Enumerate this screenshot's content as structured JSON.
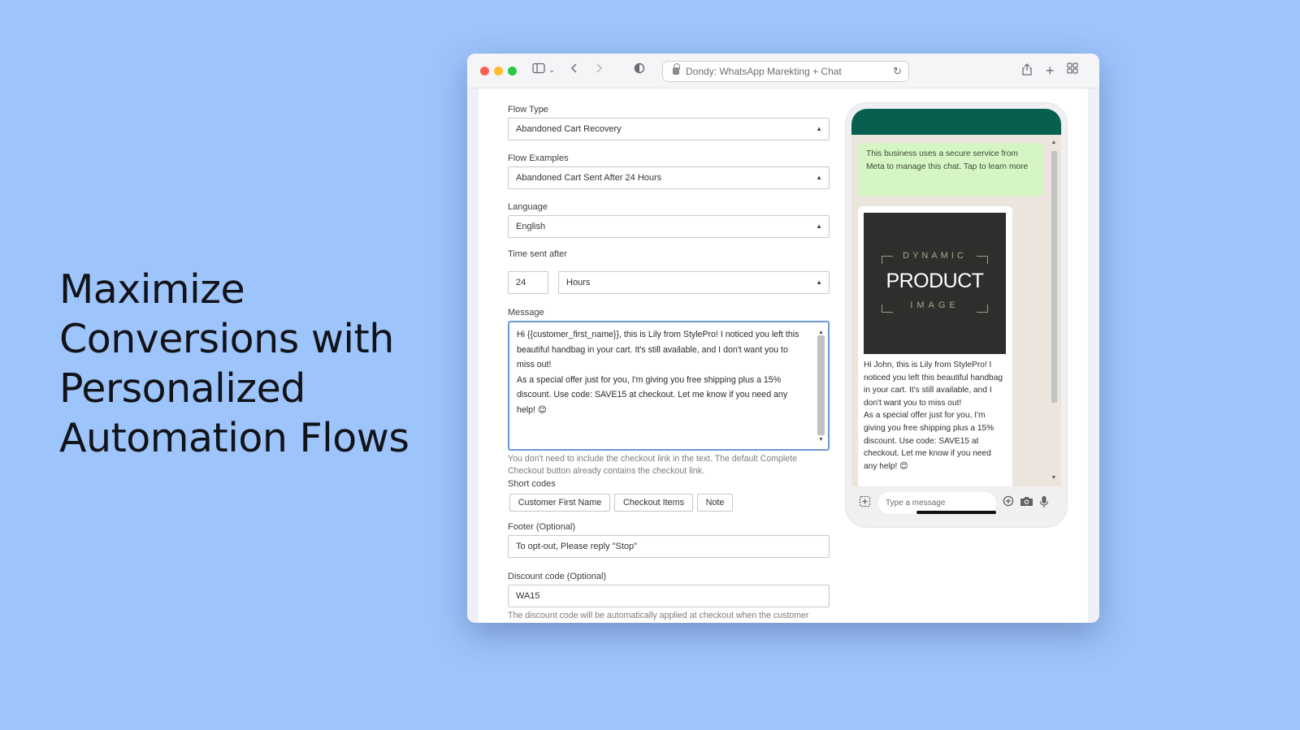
{
  "headline": [
    "Maximize",
    "Conversions with",
    "Personalized",
    "Automation Flows"
  ],
  "browser": {
    "address": "Dondy: WhatsApp Marekting + Chat",
    "icons": [
      "sidebar-icon",
      "chevron-down-icon",
      "back-icon",
      "forward-icon",
      "privacy-shield-icon",
      "lock-icon",
      "reload-icon",
      "share-icon",
      "new-tab-icon",
      "tab-overview-icon"
    ]
  },
  "form": {
    "flow_type": {
      "label": "Flow Type",
      "value": "Abandoned Cart Recovery"
    },
    "flow_examples": {
      "label": "Flow Examples",
      "value": "Abandoned Cart Sent After 24 Hours"
    },
    "language": {
      "label": "Language",
      "value": "English"
    },
    "time_sent": {
      "label": "Time sent after",
      "amount": "24",
      "unit": "Hours"
    },
    "message": {
      "label": "Message",
      "line1": "Hi {{customer_first_name}}, this is Lily from StylePro! I noticed you left this beautiful handbag in your cart. It's still available, and I don't want you to miss out!",
      "line2": "As a special offer just for you, I'm giving you free shipping plus a 15% discount. Use code: SAVE15 at checkout. Let me know if you need any help! 😊"
    },
    "checkout_hint": "You don't need to include the checkout link in the text. The default Complete Checkout button already contains the checkout link.",
    "short_codes": {
      "label": "Short codes",
      "items": [
        "Customer First Name",
        "Checkout Items",
        "Note"
      ]
    },
    "footer": {
      "label": "Footer (Optional)",
      "value": "To opt-out, Please reply \"Stop\""
    },
    "discount": {
      "label": "Discount code (Optional)",
      "value": "WA15",
      "hint": "The discount code will be automatically applied at checkout when the customer"
    }
  },
  "preview": {
    "security_notice": "This business uses a secure service from Meta to manage this chat. Tap to learn more",
    "product_image": {
      "top": "DYNAMIC",
      "middle": "PRODUCT",
      "bottom": "IMAGE"
    },
    "message_line1": "Hi John, this is Lily from StylePro! I noticed you left this beautiful handbag in your cart. It's still available, and I don't want you to miss out!",
    "message_line2": "As a special offer just for you, I'm giving you free shipping plus a 15% discount. Use code: SAVE15 at checkout. Let me know if you need any help! 😊",
    "input_placeholder": "Type a message"
  },
  "colors": {
    "background": "#9dc4fb",
    "whatsapp_header": "#07604f",
    "security_bubble": "#d6f5c4",
    "chat_background": "#ece5dd",
    "focus_border": "#6b98d8"
  }
}
